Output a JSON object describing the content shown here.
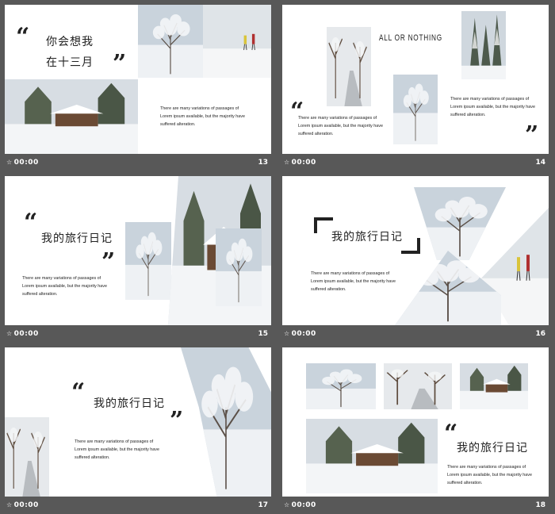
{
  "body_text": [
    "There are many variations of passages of",
    "Lorem ipsum available, but the majority have",
    "suffered alteration."
  ],
  "quote_open": "“",
  "quote_close": "”",
  "slides": [
    {
      "num": "13",
      "time": "00:00",
      "title_line1": "你会想我",
      "title_line2": "在十三月"
    },
    {
      "num": "14",
      "time": "00:00",
      "heading": "ALL OR NOTHING"
    },
    {
      "num": "15",
      "time": "00:00",
      "title": "我的旅行日记"
    },
    {
      "num": "16",
      "time": "00:00",
      "title": "我的旅行日记"
    },
    {
      "num": "17",
      "time": "00:00",
      "title": "我的旅行日记"
    },
    {
      "num": "18",
      "time": "00:00",
      "title": "我的旅行日记"
    }
  ],
  "colors": {
    "background": "#585858",
    "slide": "#ffffff",
    "text": "#222222"
  }
}
